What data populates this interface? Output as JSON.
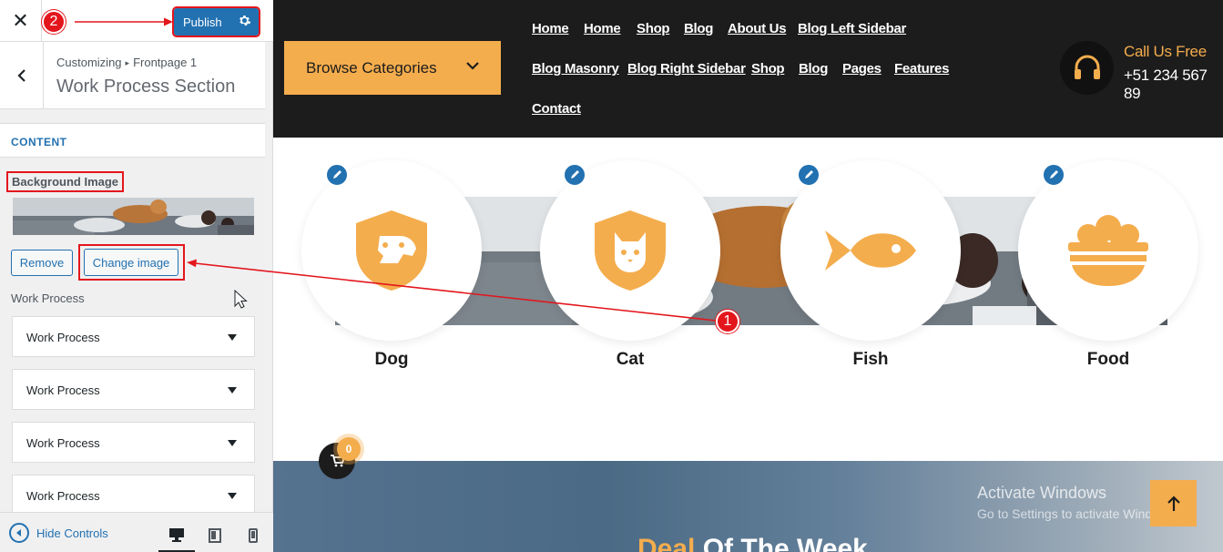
{
  "customizer": {
    "publish_label": "Publish",
    "breadcrumb_root": "Customizing",
    "breadcrumb_page": "Frontpage 1",
    "section_title": "Work Process Section",
    "content_tab": "CONTENT",
    "background_image_label": "Background Image",
    "remove_label": "Remove",
    "change_image_label": "Change image",
    "work_process_label": "Work Process",
    "work_process_items": [
      "Work Process",
      "Work Process",
      "Work Process",
      "Work Process"
    ],
    "hide_controls_label": "Hide Controls"
  },
  "annotations": {
    "step_1": "1",
    "step_2": "2"
  },
  "site": {
    "browse_categories": "Browse Categories",
    "nav": {
      "row1": [
        "Home",
        "Home",
        "Shop",
        "Blog",
        "About Us",
        "Blog Left Sidebar"
      ],
      "row2": [
        "Blog Masonry",
        "Blog Right Sidebar",
        "Shop",
        "Blog",
        "Pages",
        "Features"
      ],
      "row3": [
        "Contact"
      ]
    },
    "call_label": "Call Us Free",
    "call_number": "+51 234 567 89",
    "categories": [
      {
        "name": "Dog",
        "icon": "dog-shield-icon"
      },
      {
        "name": "Cat",
        "icon": "cat-shield-icon"
      },
      {
        "name": "Fish",
        "icon": "fish-icon"
      },
      {
        "name": "Food",
        "icon": "food-bowl-icon"
      }
    ],
    "cart_count": "0",
    "deal_title_highlight": "Deal",
    "deal_title_rest": " Of The Week"
  },
  "os_watermark": {
    "title": "Activate Windows",
    "subtitle": "Go to Settings to activate Windows."
  },
  "colors": {
    "accent": "#f4ad4d",
    "header_bg": "#1c1c1c",
    "wp_blue": "#2271b1",
    "annotation_red": "#e3161c"
  }
}
